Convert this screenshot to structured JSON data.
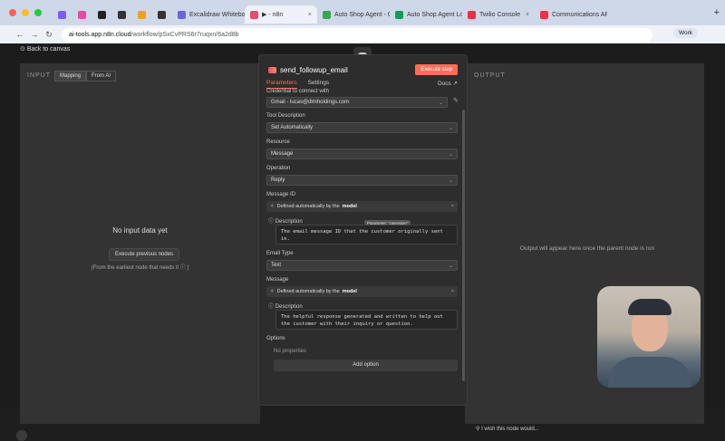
{
  "browser": {
    "tabs": [
      {
        "label": "",
        "color": "#7b5cff"
      },
      {
        "label": "",
        "color": "#e84ba0"
      },
      {
        "label": "",
        "color": "#222222"
      },
      {
        "label": "",
        "color": "#333333"
      },
      {
        "label": "",
        "color": "#f0a020"
      },
      {
        "label": "",
        "color": "#333333"
      },
      {
        "label": "Excalidraw Whiteboa...",
        "color": "#6965db"
      },
      {
        "label": "▶ - n8n",
        "color": "#ea4b71",
        "active": true
      },
      {
        "label": "Auto Shop Agent - Go...",
        "color": "#34a853"
      },
      {
        "label": "Auto Shop Agent Log...",
        "color": "#0f9d58"
      },
      {
        "label": "Twilio Console",
        "color": "#f22f46"
      },
      {
        "label": "Communications APIs...",
        "color": "#f22f46"
      }
    ],
    "url_host": "ai-tools.app.n8n.cloud",
    "url_path": "/workflow/pSxCvPRS6r7ruqxn/6a2d8b",
    "profile": "Work"
  },
  "app": {
    "back_label": "Back to canvas",
    "input": {
      "title": "INPUT",
      "seg": [
        "Mapping",
        "From AI"
      ],
      "empty_title": "No input data yet",
      "exec_prev": "Execute previous nodes",
      "empty_sub": "(From the earliest node that needs it ⓘ )"
    },
    "output": {
      "title": "OUTPUT",
      "message": "Output will appear here once the parent node is run"
    },
    "node": {
      "title": "send_followup_email",
      "execute": "Execute step",
      "tabs": [
        "Parameters",
        "Settings"
      ],
      "docs": "Docs ↗",
      "credential_label": "Credential to connect with",
      "credential_value": "Gmail - lucas@dlmholdings.com",
      "tool_desc_label": "Tool Description",
      "tool_desc_value": "Set Automatically",
      "resource_label": "Resource",
      "resource_value": "Message",
      "operation_label": "Operation",
      "operation_value": "Reply",
      "msgid_label": "Message ID",
      "auto_text": "Defined automatically by the",
      "auto_bold": "model",
      "tooltip": "Parameter: \"operation\"",
      "desc_label": "Description",
      "msgid_desc": "The email message ID that the customer originally sent in.",
      "email_type_label": "Email Type",
      "email_type_value": "Text",
      "message_label": "Message",
      "message_desc": "The helpful response generated and written to help out the customer with their inquiry or question.",
      "options_label": "Options",
      "no_props": "No properties",
      "add_option": "Add option"
    },
    "wish": "I wish this node would..."
  }
}
